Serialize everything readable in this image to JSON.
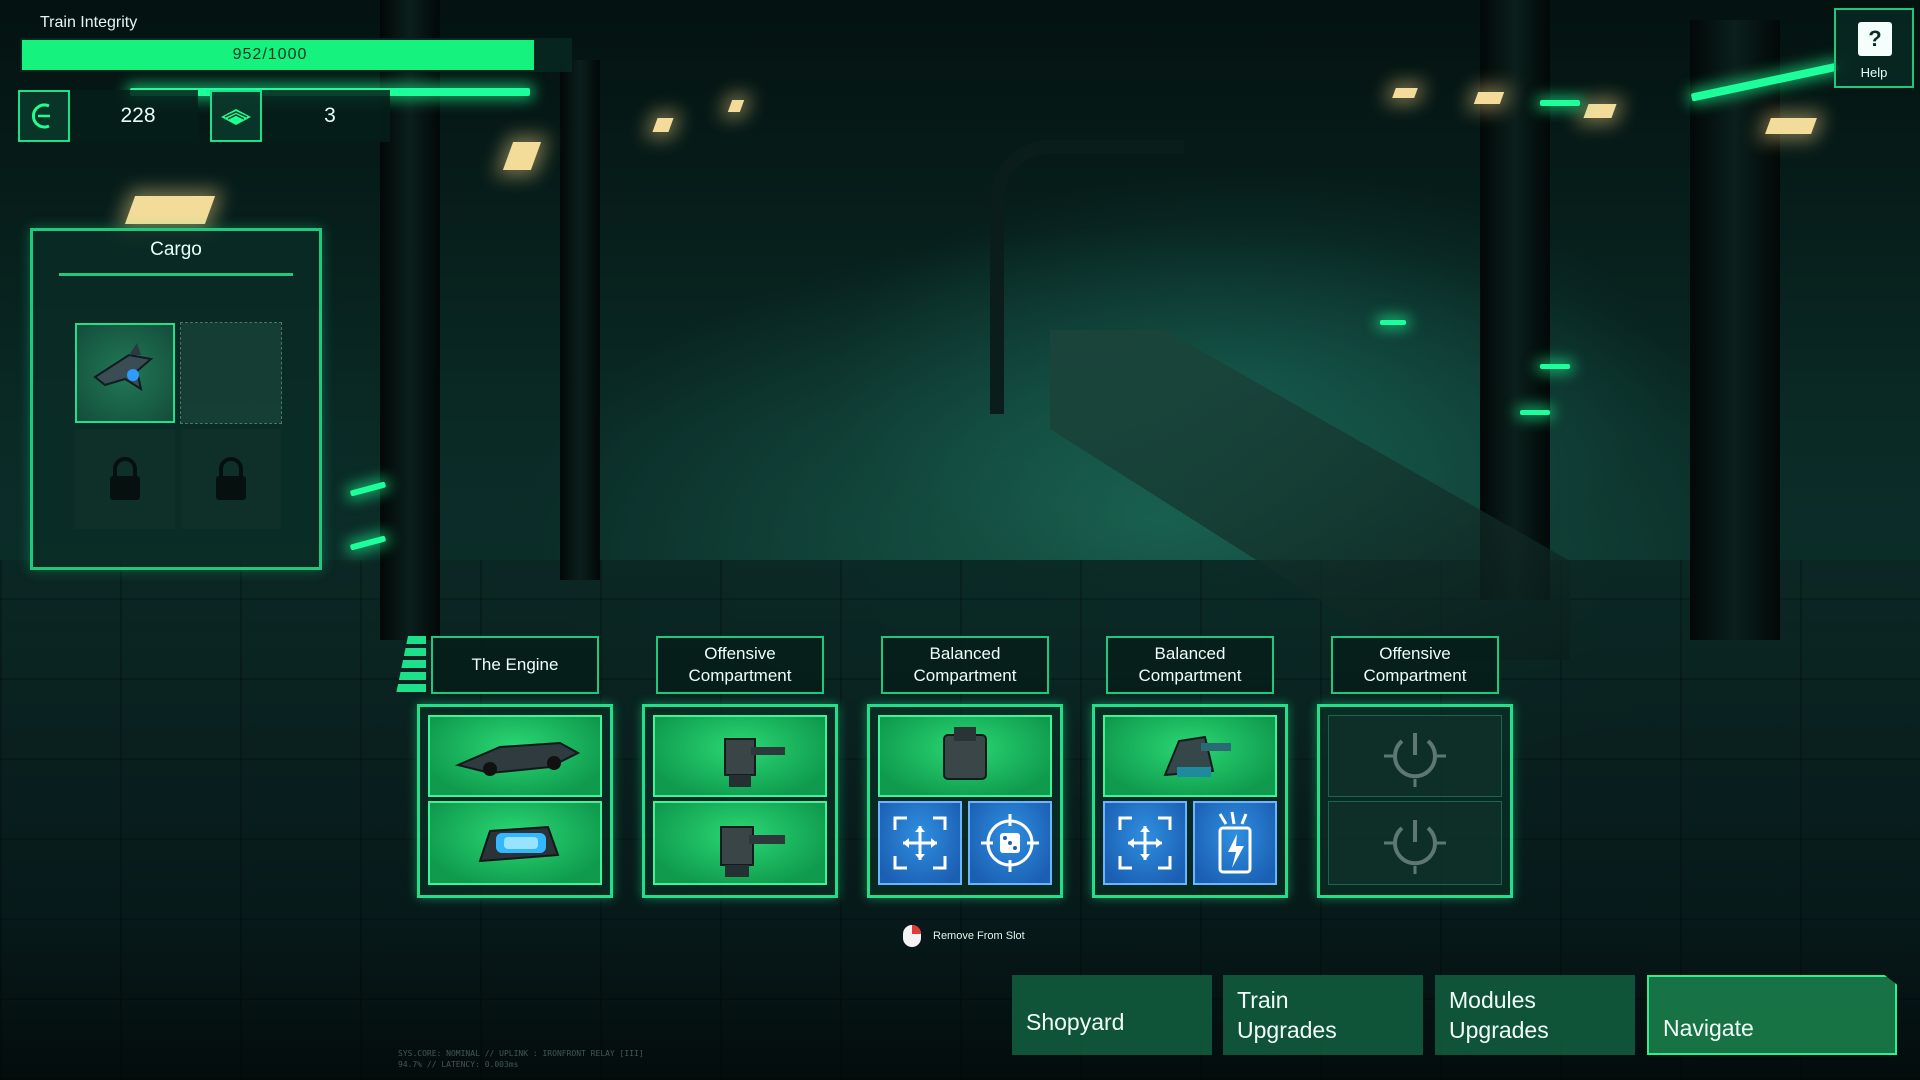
{
  "hud": {
    "integrity_label": "Train Integrity",
    "integrity_text": "952/1000",
    "integrity_value": 952,
    "integrity_max": 1000,
    "scrap_icon": "scrap-crescent-icon",
    "scrap_value": "228",
    "chip_icon": "chip-icon",
    "chip_value": "3"
  },
  "cargo": {
    "title": "Cargo",
    "slots": [
      {
        "state": "filled",
        "icon": "drone-module-icon"
      },
      {
        "state": "empty"
      },
      {
        "state": "locked",
        "icon": "padlock-icon"
      },
      {
        "state": "locked",
        "icon": "padlock-icon"
      }
    ]
  },
  "help": {
    "symbol": "?",
    "label": "Help"
  },
  "compartments": [
    {
      "title": "The Engine",
      "slots": [
        "engine-chassis-icon",
        "engine-core-icon"
      ]
    },
    {
      "title": "Offensive Compartment",
      "slots": [
        "turret-icon",
        "turret-icon"
      ]
    },
    {
      "title": "Balanced Compartment",
      "slots": [
        "mortar-icon",
        "crosshair-expand-icon",
        "dice-target-icon"
      ]
    },
    {
      "title": "Balanced Compartment",
      "slots": [
        "cannon-icon",
        "crosshair-expand-icon",
        "battery-bolt-icon"
      ]
    },
    {
      "title": "Offensive Compartment",
      "slots": [
        "empty-power-slot-icon",
        "empty-power-slot-icon"
      ]
    }
  ],
  "hint": {
    "icon": "mouse-right-click-icon",
    "label": "Remove From Slot"
  },
  "nav": {
    "shopyard": "Shopyard",
    "train_upgrades_1": "Train",
    "train_upgrades_2": "Upgrades",
    "modules_upgrades_1": "Modules",
    "modules_upgrades_2": "Upgrades",
    "navigate": "Navigate"
  },
  "status": {
    "line1": "SYS.CORE: NOMINAL // UPLINK : IRONFRONT RELAY [III]",
    "line2": "94.7% // LATENCY: 0.003ms"
  },
  "colors": {
    "accent": "#1ec97c",
    "integrity_fill": "#15f27e",
    "module_green": "#2bd874",
    "module_blue": "#2f8fe0"
  }
}
